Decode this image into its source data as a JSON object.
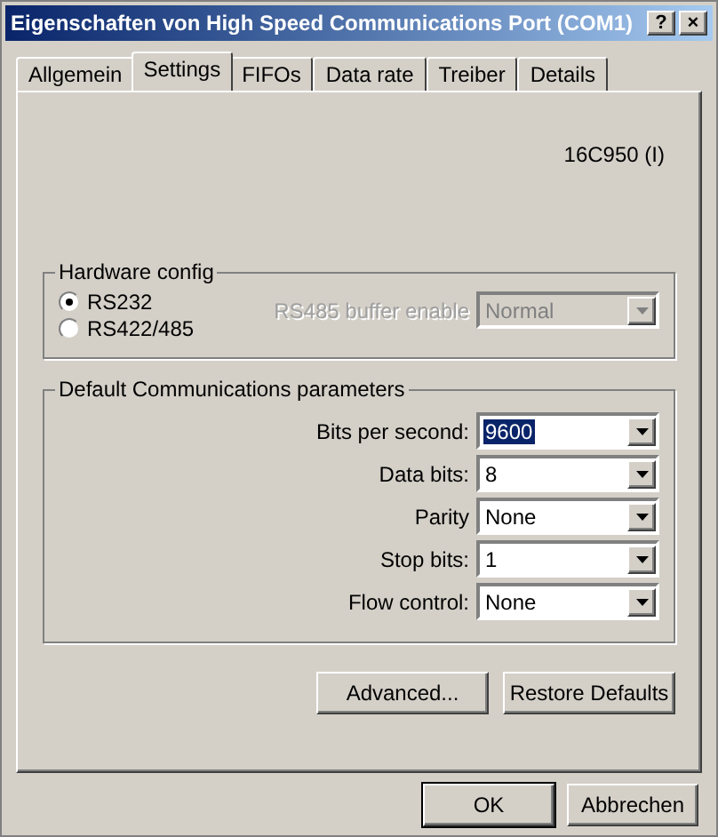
{
  "window": {
    "title": "Eigenschaften von High Speed Communications Port (COM1)",
    "title_buttons": [
      "?",
      "×"
    ]
  },
  "tabs": [
    {
      "label": "Allgemein",
      "selected": false
    },
    {
      "label": "Settings",
      "selected": true
    },
    {
      "label": "FIFOs",
      "selected": false
    },
    {
      "label": "Data rate",
      "selected": false
    },
    {
      "label": "Treiber",
      "selected": false
    },
    {
      "label": "Details",
      "selected": false
    }
  ],
  "chip": "16C950 (I)",
  "hardware_config": {
    "title": "Hardware config",
    "radios": [
      {
        "label": "RS232",
        "selected": true
      },
      {
        "label": "RS422/485",
        "selected": false
      }
    ],
    "buffer": {
      "label": "RS485 buffer enable",
      "value": "Normal",
      "disabled": true
    }
  },
  "comm_params": {
    "title": "Default Communications parameters",
    "fields": [
      {
        "label": "Bits per second:",
        "value": "9600",
        "focused": true
      },
      {
        "label": "Data bits:",
        "value": "8",
        "focused": false
      },
      {
        "label": "Parity",
        "value": "None",
        "focused": false
      },
      {
        "label": "Stop bits:",
        "value": "1",
        "focused": false
      },
      {
        "label": "Flow control:",
        "value": "None",
        "focused": false
      }
    ]
  },
  "panel_buttons": [
    "Advanced...",
    "Restore Defaults"
  ],
  "dialog_buttons": [
    {
      "label": "OK",
      "default": true
    },
    {
      "label": "Abbrechen",
      "default": false
    }
  ]
}
